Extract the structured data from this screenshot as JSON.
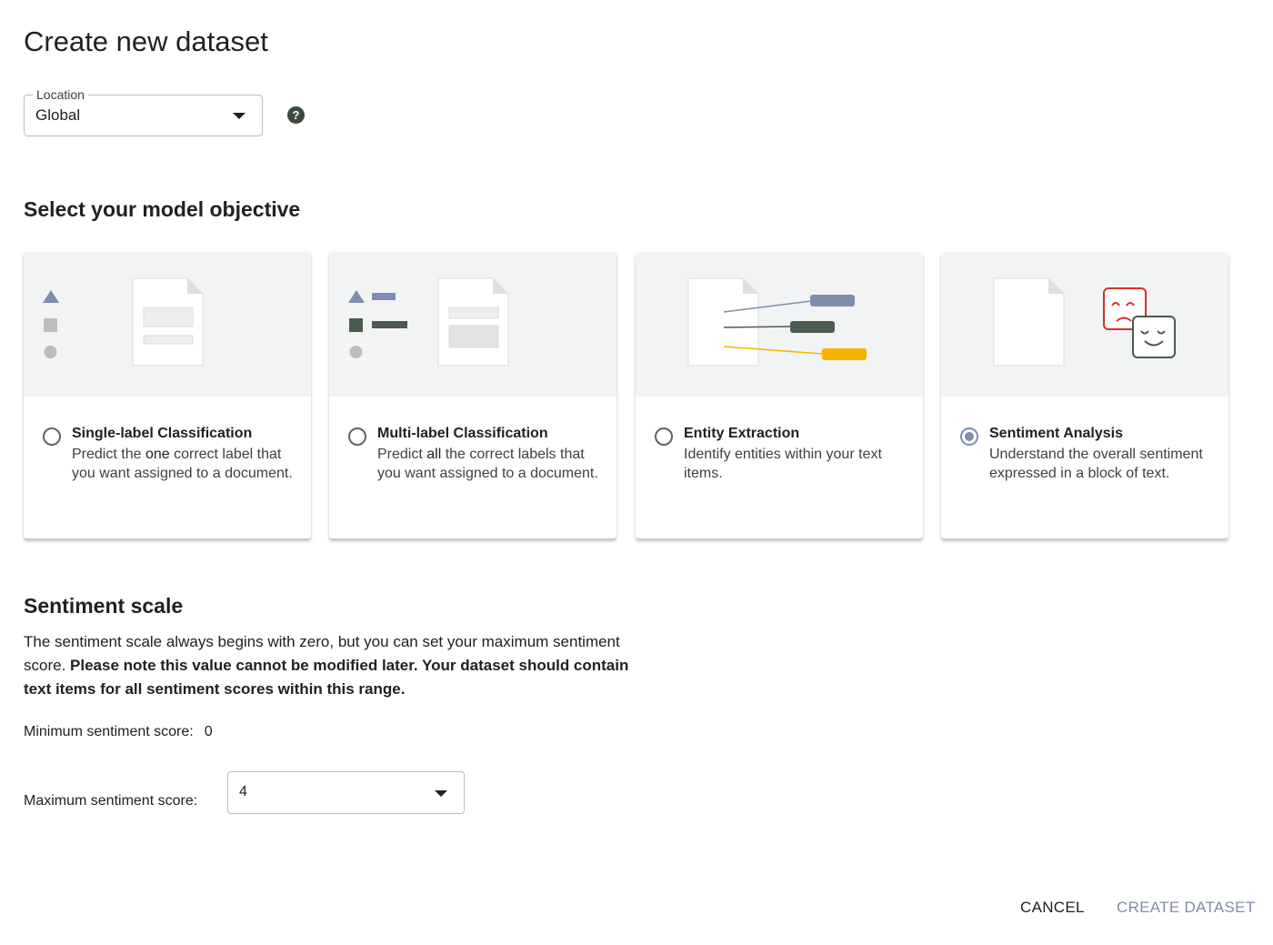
{
  "page": {
    "title": "Create new dataset"
  },
  "location": {
    "label": "Location",
    "value": "Global"
  },
  "objective": {
    "heading": "Select your model objective",
    "cards": [
      {
        "title": "Single-label Classification",
        "desc_pre": "Predict the ",
        "desc_emph": "one",
        "desc_post": " correct label that you want assigned to a document.",
        "selected": false
      },
      {
        "title": "Multi-label Classification",
        "desc_pre": "Predict ",
        "desc_emph": "all",
        "desc_post": " the correct labels that you want assigned to a document.",
        "selected": false
      },
      {
        "title": "Entity Extraction",
        "desc_pre": "Identify entities within your text items.",
        "desc_emph": "",
        "desc_post": "",
        "selected": false
      },
      {
        "title": "Sentiment Analysis",
        "desc_pre": "Understand the overall sentiment expressed in a block of text.",
        "desc_emph": "",
        "desc_post": "",
        "selected": true
      }
    ]
  },
  "sentiment": {
    "heading": "Sentiment scale",
    "text_plain": "The sentiment scale always begins with zero, but you can set your maximum sentiment score. ",
    "text_bold": "Please note this value cannot be modified later. Your dataset should contain text items for all sentiment scores within this range.",
    "min_label": "Minimum sentiment score:",
    "min_value": "0",
    "max_label": "Maximum sentiment score:",
    "max_value": "4"
  },
  "actions": {
    "cancel": "CANCEL",
    "create": "CREATE DATASET"
  },
  "colors": {
    "accent_blue": "#7f8db0",
    "dark_green": "#4b5b4f",
    "amber": "#f4b400",
    "sad_red": "#d93025"
  }
}
